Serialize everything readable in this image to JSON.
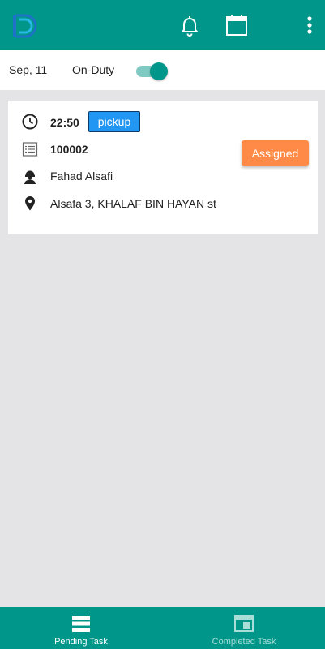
{
  "app": {
    "logo_text": "D",
    "colors": {
      "primary": "#00978a",
      "badge": "#2196f3",
      "assigned": "#ff8a47",
      "background": "#e4e4e6"
    },
    "icons": {
      "notifications": "bell-icon",
      "calendar": "calendar-icon",
      "menu": "more-vert-icon"
    }
  },
  "duty": {
    "date": "Sep, 11",
    "status_label": "On-Duty",
    "toggle_on": true
  },
  "task": {
    "time": "22:50",
    "type": "pickup",
    "order_id": "100002",
    "customer": "Fahad Alsafi",
    "address": "Alsafa 3, KHALAF BIN HAYAN st",
    "status": "Assigned"
  },
  "bottom_nav": {
    "items": [
      {
        "label": "Pending Task",
        "icon": "list-icon",
        "active": true
      },
      {
        "label": "Completed Task",
        "icon": "window-icon",
        "active": false
      }
    ]
  }
}
